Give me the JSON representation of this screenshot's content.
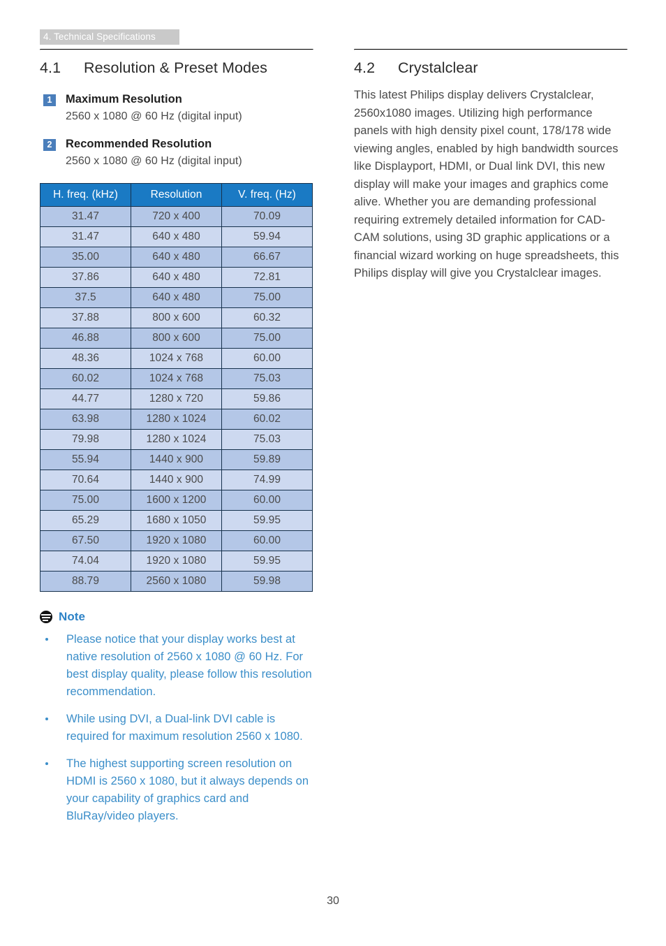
{
  "document": {
    "running_header": "4. Technical Specifications",
    "page_number": "30"
  },
  "colors": {
    "header_bar": "#c9c9c9",
    "table_header": "#1a7ac4",
    "row_odd": "#b4c7e7",
    "row_even": "#cdd9f0",
    "badge": "#4a7ebb",
    "note_blue": "#3b8ec9"
  },
  "left_column": {
    "section": {
      "number": "4.1",
      "title": "Resolution & Preset Modes"
    },
    "items": [
      {
        "badge": "1",
        "heading": "Maximum Resolution",
        "detail": "2560 x 1080 @ 60 Hz (digital input)"
      },
      {
        "badge": "2",
        "heading": "Recommended Resolution",
        "detail": "2560 x 1080 @ 60 Hz (digital input)"
      }
    ],
    "table": {
      "columns": [
        "H. freq. (kHz)",
        "Resolution",
        "V. freq. (Hz)"
      ],
      "rows": [
        [
          "31.47",
          "720 x 400",
          "70.09"
        ],
        [
          "31.47",
          "640 x 480",
          "59.94"
        ],
        [
          "35.00",
          "640 x 480",
          "66.67"
        ],
        [
          "37.86",
          "640 x 480",
          "72.81"
        ],
        [
          "37.5",
          "640 x 480",
          "75.00"
        ],
        [
          "37.88",
          "800 x 600",
          "60.32"
        ],
        [
          "46.88",
          "800 x 600",
          "75.00"
        ],
        [
          "48.36",
          "1024 x 768",
          "60.00"
        ],
        [
          "60.02",
          "1024 x 768",
          "75.03"
        ],
        [
          "44.77",
          "1280 x 720",
          "59.86"
        ],
        [
          "63.98",
          "1280 x 1024",
          "60.02"
        ],
        [
          "79.98",
          "1280 x 1024",
          "75.03"
        ],
        [
          "55.94",
          "1440 x 900",
          "59.89"
        ],
        [
          "70.64",
          "1440 x 900",
          "74.99"
        ],
        [
          "75.00",
          "1600 x 1200",
          "60.00"
        ],
        [
          "65.29",
          "1680 x 1050",
          "59.95"
        ],
        [
          "67.50",
          "1920 x 1080",
          "60.00"
        ],
        [
          "74.04",
          "1920 x 1080",
          "59.95"
        ],
        [
          "88.79",
          "2560 x 1080",
          "59.98"
        ]
      ]
    },
    "note": {
      "icon": "note-lines-icon",
      "title": "Note",
      "bullets": [
        "Please notice that your display works best at native resolution of 2560 x 1080 @ 60 Hz. For best display quality, please follow this resolution recommendation.",
        "While using DVI, a Dual-link DVI cable is required for maximum resolution 2560 x 1080.",
        "The highest supporting screen resolution on HDMI is 2560 x 1080, but it always depends on your capability of graphics card and BluRay/video players."
      ]
    }
  },
  "right_column": {
    "section": {
      "number": "4.2",
      "title": "Crystalclear"
    },
    "paragraph": "This latest Philips display delivers Crystalclear, 2560x1080 images. Utilizing high performance panels with high density pixel count, 178/178 wide viewing angles, enabled by high bandwidth sources like Displayport, HDMI, or Dual link DVI, this new display will make your images and graphics come alive. Whether you are demanding professional requiring extremely detailed information for CAD-CAM solutions, using 3D graphic applications or a financial wizard working on huge spreadsheets, this Philips display will give you Crystalclear images."
  }
}
